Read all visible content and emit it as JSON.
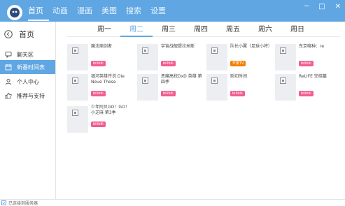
{
  "app": {
    "colors": {
      "accent": "#5fa6e3",
      "bilibili": "#f25d8e",
      "mango": "#f77f00"
    }
  },
  "topnav": {
    "items": [
      {
        "label": "首页",
        "active": true
      },
      {
        "label": "动画"
      },
      {
        "label": "漫画"
      },
      {
        "label": "美图"
      },
      {
        "label": "搜索"
      },
      {
        "label": "设置"
      }
    ],
    "window_controls": {
      "minimize": "─",
      "maximize": "□",
      "close": "✕"
    }
  },
  "sidebar": {
    "home_label": "首页",
    "items": [
      {
        "label": "聊天区",
        "icon": "chat-icon"
      },
      {
        "label": "新番时间表",
        "icon": "calendar-icon",
        "active": true
      },
      {
        "label": "个人中心",
        "icon": "user-icon"
      },
      {
        "label": "推荐与支持",
        "icon": "thumbs-up-icon"
      }
    ]
  },
  "days": {
    "tabs": [
      "周一",
      "周二",
      "周三",
      "周四",
      "周五",
      "周六",
      "周日"
    ],
    "active_index": 1
  },
  "cards": [
    {
      "title": "魔法崩剑者",
      "badge": "bilibili",
      "badge_type": "bilibili"
    },
    {
      "title": "宇宙战舰提拉米斯",
      "badge": "bilibili",
      "badge_type": "bilibili"
    },
    {
      "title": "队长小翼（足球小将）",
      "badge": "芒果TV",
      "badge_type": "mango"
    },
    {
      "title": "东京喰种：re",
      "badge": "bilibili",
      "badge_type": "bilibili"
    },
    {
      "title": "银河英雄传说 Die Neue These",
      "badge": "bilibili",
      "badge_type": "bilibili"
    },
    {
      "title": "恶魔高校DxD 英雄 第四季",
      "badge": "bilibili",
      "badge_type": "bilibili"
    },
    {
      "title": "蹈切时间",
      "badge": "bilibili",
      "badge_type": "bilibili"
    },
    {
      "title": "ReLIFE 完结篇",
      "badge": "bilibili",
      "badge_type": "bilibili"
    },
    {
      "title": "少年阿贝GO！GO！小芝麻 第3季",
      "badge": "bilibili",
      "badge_type": "bilibili"
    }
  ],
  "status": {
    "text": "已连接到服务器"
  }
}
